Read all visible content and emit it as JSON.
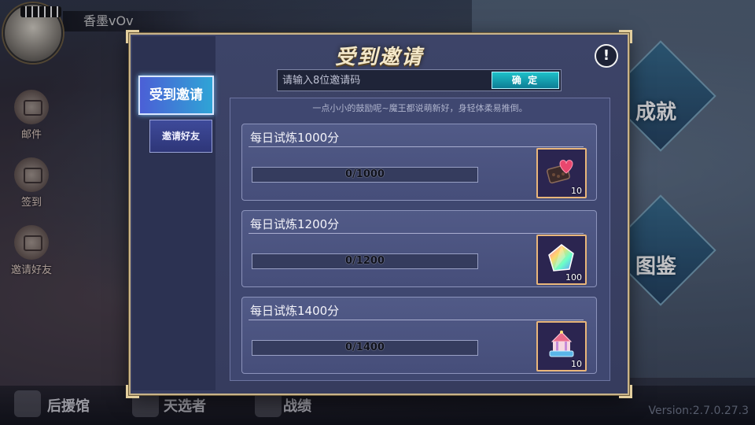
{
  "background": {
    "username": "香墨vOv",
    "side_menu": [
      "邮件",
      "签到",
      "邀请好友"
    ],
    "right_menu": [
      "成就",
      "图鉴"
    ],
    "bottom_nav": [
      "后援馆",
      "天选者",
      "战绩"
    ],
    "version": "Version:2.7.0.27.3"
  },
  "modal": {
    "title": "受到邀请",
    "tabs": [
      {
        "label": "受到邀请",
        "active": true
      },
      {
        "label": "邀请好友",
        "active": false
      }
    ],
    "code_input": {
      "placeholder": "请输入8位邀请码",
      "value": ""
    },
    "confirm_label": "确 定",
    "hint": "一点小小的鼓励呢~魔王都说萌新好，身轻体柔易推倒。",
    "rewards": [
      {
        "title": "每日试炼1000分",
        "progress_text": "0/1000",
        "progress": 0,
        "item": "heart-chocolate-box-icon",
        "quantity": "10"
      },
      {
        "title": "每日试炼1200分",
        "progress_text": "0/1200",
        "progress": 0,
        "item": "rainbow-crystal-icon",
        "quantity": "100"
      },
      {
        "title": "每日试炼1400分",
        "progress_text": "0/1400",
        "progress": 0,
        "item": "carousel-cake-icon",
        "quantity": "10"
      }
    ]
  },
  "colors": {
    "accent": "#2fa4d6",
    "frame_gold": "#c9b48a",
    "confirm": "#1ec1c9",
    "item_border": "#e9b67a"
  }
}
